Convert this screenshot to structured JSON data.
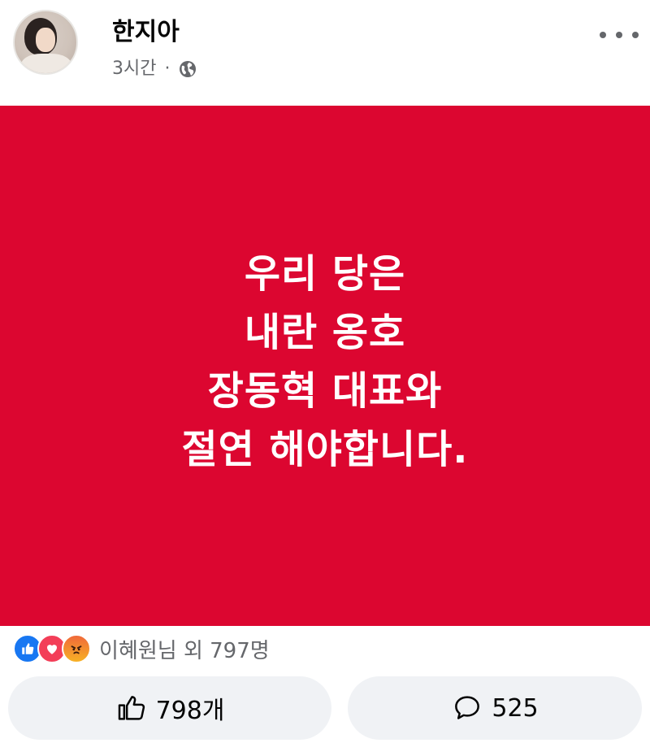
{
  "post": {
    "author": "한지아",
    "time": "3시간",
    "separator": "·",
    "privacy_icon": "globe-icon",
    "image_background": "#dc0630",
    "image_text_lines": [
      "우리 당은",
      "내란 옹호",
      "장동혁 대표와",
      "절연 해야합니다."
    ]
  },
  "reactions": {
    "icons": [
      "like-reaction",
      "love-reaction",
      "angry-reaction"
    ],
    "summary": "이혜원님 외 797명"
  },
  "actions": {
    "like_count": "798개",
    "comment_count": "525"
  },
  "colors": {
    "like": "#1877f2",
    "love": "#f33e58",
    "angry": "#f0693a"
  }
}
